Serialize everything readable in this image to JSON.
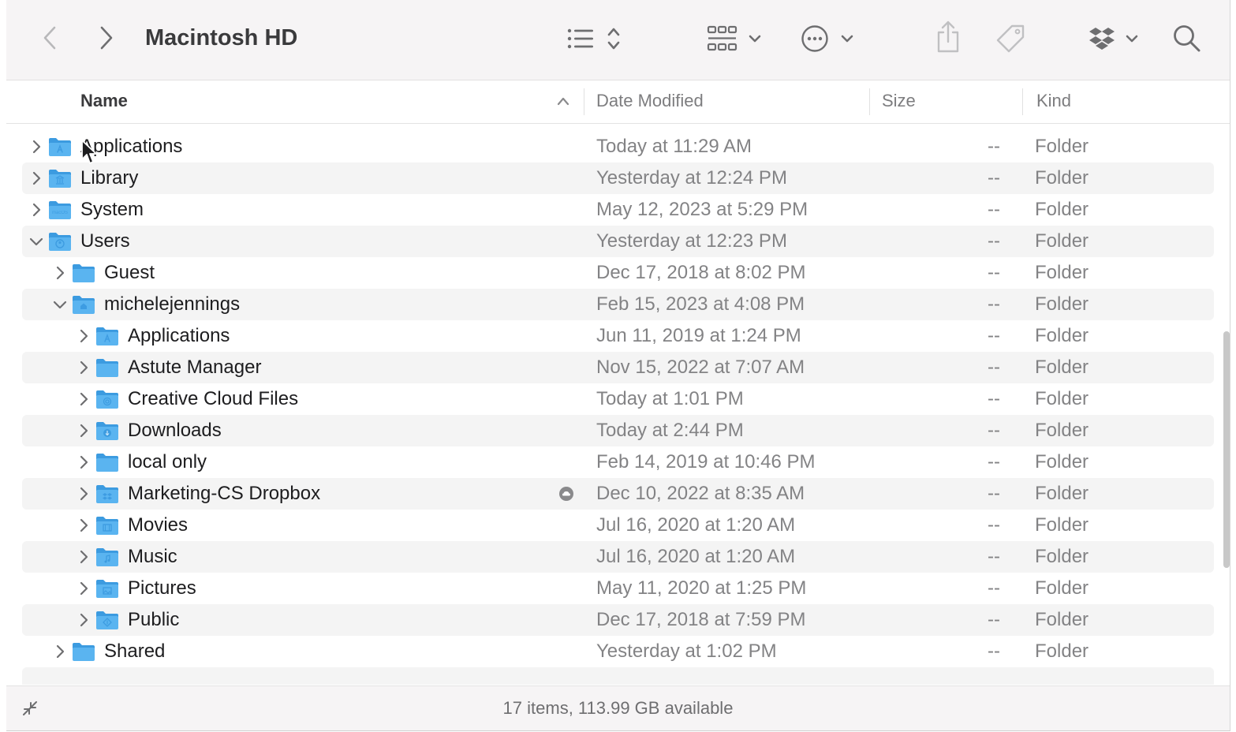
{
  "window": {
    "title": "Macintosh HD"
  },
  "toolbar": {
    "back_icon": "chevron-left-icon",
    "forward_icon": "chevron-right-icon",
    "view_icon": "list-view-icon",
    "group_icon": "grid-group-icon",
    "action_icon": "ellipsis-circle-icon",
    "share_icon": "share-icon",
    "tag_icon": "tag-icon",
    "dropbox_icon": "dropbox-icon",
    "search_icon": "search-icon"
  },
  "columns": {
    "name": "Name",
    "date": "Date Modified",
    "size": "Size",
    "kind": "Kind"
  },
  "rows": [
    {
      "name": "Applications",
      "date": "Today at 11:29 AM",
      "size": "--",
      "kind": "Folder",
      "depth": 0,
      "expanded": false,
      "glyph": "app"
    },
    {
      "name": "Library",
      "date": "Yesterday at 12:24 PM",
      "size": "--",
      "kind": "Folder",
      "depth": 0,
      "expanded": false,
      "glyph": "library"
    },
    {
      "name": "System",
      "date": "May 12, 2023 at 5:29 PM",
      "size": "--",
      "kind": "Folder",
      "depth": 0,
      "expanded": false,
      "glyph": "system"
    },
    {
      "name": "Users",
      "date": "Yesterday at 12:23 PM",
      "size": "--",
      "kind": "Folder",
      "depth": 0,
      "expanded": true,
      "glyph": "user"
    },
    {
      "name": "Guest",
      "date": "Dec 17, 2018 at 8:02 PM",
      "size": "--",
      "kind": "Folder",
      "depth": 1,
      "expanded": false,
      "glyph": "plain"
    },
    {
      "name": "michelejennings",
      "date": "Feb 15, 2023 at 4:08 PM",
      "size": "--",
      "kind": "Folder",
      "depth": 1,
      "expanded": true,
      "glyph": "home"
    },
    {
      "name": "Applications",
      "date": "Jun 11, 2019 at 1:24 PM",
      "size": "--",
      "kind": "Folder",
      "depth": 2,
      "expanded": false,
      "glyph": "app"
    },
    {
      "name": "Astute Manager",
      "date": "Nov 15, 2022 at 7:07 AM",
      "size": "--",
      "kind": "Folder",
      "depth": 2,
      "expanded": false,
      "glyph": "plain"
    },
    {
      "name": "Creative Cloud Files",
      "date": "Today at 1:01 PM",
      "size": "--",
      "kind": "Folder",
      "depth": 2,
      "expanded": false,
      "glyph": "cc"
    },
    {
      "name": "Downloads",
      "date": "Today at 2:44 PM",
      "size": "--",
      "kind": "Folder",
      "depth": 2,
      "expanded": false,
      "glyph": "download"
    },
    {
      "name": "local only",
      "date": "Feb 14, 2019 at 10:46 PM",
      "size": "--",
      "kind": "Folder",
      "depth": 2,
      "expanded": false,
      "glyph": "plain"
    },
    {
      "name": "Marketing-CS Dropbox",
      "date": "Dec 10, 2022 at 8:35 AM",
      "size": "--",
      "kind": "Folder",
      "depth": 2,
      "expanded": false,
      "glyph": "dropbox",
      "cloud": true
    },
    {
      "name": "Movies",
      "date": "Jul 16, 2020 at 1:20 AM",
      "size": "--",
      "kind": "Folder",
      "depth": 2,
      "expanded": false,
      "glyph": "movie"
    },
    {
      "name": "Music",
      "date": "Jul 16, 2020 at 1:20 AM",
      "size": "--",
      "kind": "Folder",
      "depth": 2,
      "expanded": false,
      "glyph": "music"
    },
    {
      "name": "Pictures",
      "date": "May 11, 2020 at 1:25 PM",
      "size": "--",
      "kind": "Folder",
      "depth": 2,
      "expanded": false,
      "glyph": "picture"
    },
    {
      "name": "Public",
      "date": "Dec 17, 2018 at 7:59 PM",
      "size": "--",
      "kind": "Folder",
      "depth": 2,
      "expanded": false,
      "glyph": "public"
    },
    {
      "name": "Shared",
      "date": "Yesterday at 1:02 PM",
      "size": "--",
      "kind": "Folder",
      "depth": 1,
      "expanded": false,
      "glyph": "plain"
    }
  ],
  "status": {
    "text": "17 items, 113.99 GB available",
    "collapse_icon": "collapse-arrows-icon"
  },
  "colors": {
    "folder": "#5ab4f0",
    "folder_dark": "#3c9be0",
    "row_alt": "#f4f4f4",
    "secondary_text": "#838385"
  }
}
